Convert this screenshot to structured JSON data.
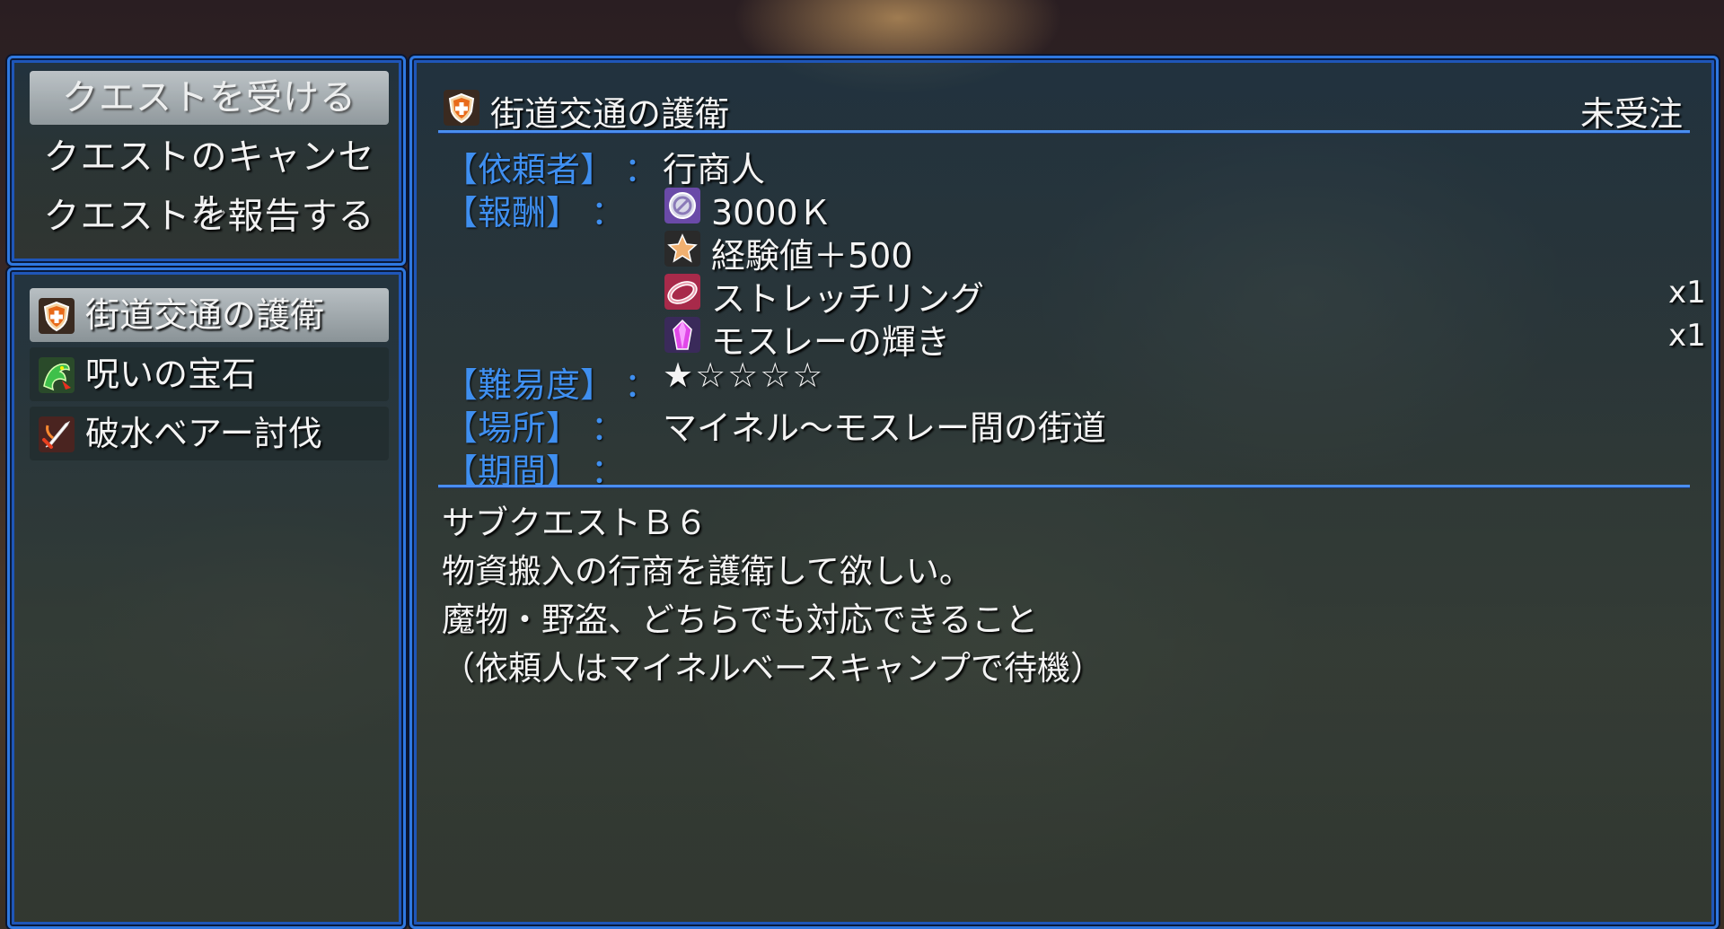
{
  "commands": [
    "クエストを受ける",
    "クエストのキャンセル",
    "クエストを報告する"
  ],
  "quest_list": [
    {
      "title": "街道交通の護衛",
      "icon": "shield-icon"
    },
    {
      "title": "呪いの宝石",
      "icon": "dragon-icon"
    },
    {
      "title": "破水ベアー討伐",
      "icon": "sword-icon"
    }
  ],
  "detail": {
    "title": "街道交通の護衛",
    "status": "未受注",
    "client_label": "【依頼者】",
    "client_value": "行商人",
    "reward_label": "【報酬】",
    "rewards": [
      {
        "icon": "coin-icon",
        "text": "3000Ｋ",
        "qty": ""
      },
      {
        "icon": "star-icon",
        "text": "経験値＋500",
        "qty": ""
      },
      {
        "icon": "ring-icon",
        "text": "ストレッチリング",
        "qty": "x1"
      },
      {
        "icon": "crystal-icon",
        "text": "モスレーの輝き",
        "qty": "x1"
      }
    ],
    "difficulty_label": "【難易度】",
    "difficulty_value": "★☆☆☆☆",
    "location_label": "【場所】",
    "location_value": "マイネル～モスレー間の街道",
    "period_label": "【期間】",
    "period_value": "",
    "colon": "：",
    "description": [
      "サブクエストＢ６",
      "物資搬入の行商を護衛して欲しい。",
      "魔物・野盗、どちらでも対応できること",
      "（依頼人はマイネルベースキャンプで待機）"
    ]
  },
  "colors": {
    "label": "#3f8ff0",
    "border": "#2f78e0",
    "text": "#f4f4f4"
  }
}
